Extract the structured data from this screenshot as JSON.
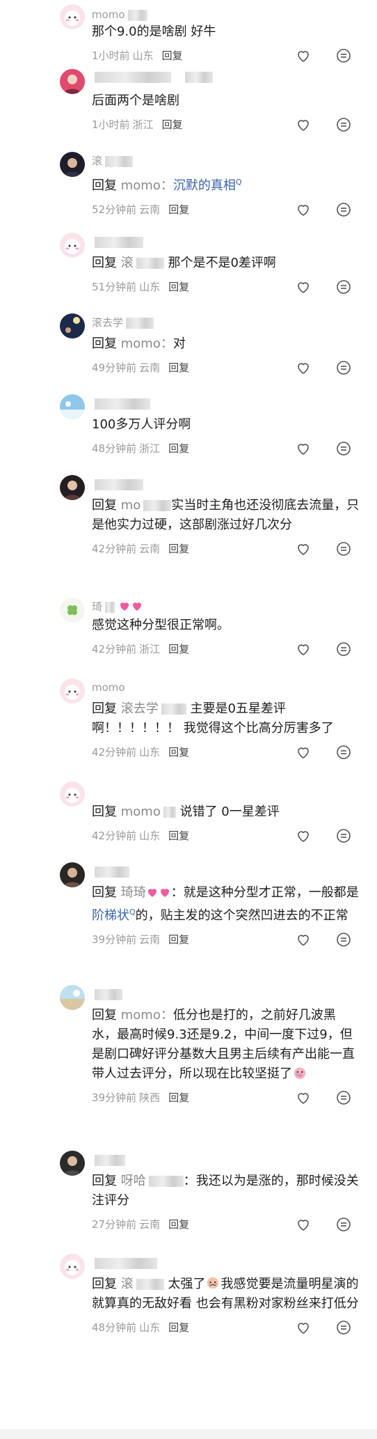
{
  "comments": [
    {
      "username": "momo",
      "content": "那个9.0的是啥剧 好牛",
      "time": "1小时前",
      "location": "山东",
      "reply_label": "回复"
    },
    {
      "username": "",
      "content": "后面两个是啥剧",
      "time": "1小时前",
      "location": "浙江",
      "reply_label": "回复"
    },
    {
      "username": "滚",
      "reply_kw": "回复",
      "ref_name": "momo：",
      "link_text": "沉默的真相",
      "time": "52分钟前",
      "location": "云南",
      "reply_label": "回复"
    },
    {
      "username": "",
      "reply_kw": "回复",
      "ref_name": "滚",
      "content": "那个是不是0差评啊",
      "time": "51分钟前",
      "location": "山东",
      "reply_label": "回复"
    },
    {
      "username": "滚去学",
      "reply_kw": "回复",
      "ref_name": "momo：",
      "content": "对",
      "time": "49分钟前",
      "location": "云南",
      "reply_label": "回复"
    },
    {
      "username": "",
      "content": "100多万人评分啊",
      "time": "48分钟前",
      "location": "浙江",
      "reply_label": "回复"
    },
    {
      "username": "",
      "reply_kw": "回复",
      "ref_name": "mo",
      "content": "实当时主角也还没彻底去流量，只是他实力过硬，这部剧涨过好几次分",
      "time": "42分钟前",
      "location": "云南",
      "reply_label": "回复"
    },
    {
      "username": "琦",
      "content": "感觉这种分型很正常啊。",
      "time": "42分钟前",
      "location": "浙江",
      "reply_label": "回复"
    },
    {
      "username": "momo",
      "reply_kw": "回复",
      "ref_name": "滚去学",
      "content": "主要是0五星差评啊！！！！！！ 我觉得这个比高分厉害多了",
      "time": "42分钟前",
      "location": "山东",
      "reply_label": "回复"
    },
    {
      "username": "",
      "reply_kw": "回复",
      "ref_name": "momo",
      "content": "说错了 0一星差评",
      "time": "42分钟前",
      "location": "山东",
      "reply_label": "回复"
    },
    {
      "username": "",
      "reply_kw": "回复",
      "ref_name": "琦琦",
      "content_a": "：就是这种分型才正常，一般都是",
      "link_text": "阶梯状",
      "content_b": "的，贴主发的这个突然凹进去的不正常",
      "time": "39分钟前",
      "location": "云南",
      "reply_label": "回复"
    },
    {
      "username": "",
      "reply_kw": "回复",
      "ref_name": "momo：",
      "content": "低分也是打的，之前好几波黑水，最高时候9.3还是9.2，中间一度下过9，但是剧口碑好评分基数大且男主后续有产出能一直带人过去评分，所以现在比较坚挺了",
      "time": "39分钟前",
      "location": "陕西",
      "reply_label": "回复"
    },
    {
      "username": "",
      "reply_kw": "回复",
      "ref_name": "呀哈",
      "content": "：我还以为是涨的，那时候没关注评分",
      "time": "27分钟前",
      "location": "云南",
      "reply_label": "回复"
    },
    {
      "username": "",
      "reply_kw": "回复",
      "ref_name": "滚",
      "content_a": "太强了",
      "content_b": "我感觉要是流量明星演的 就算真的无敌好看 也会有黑粉对家粉丝来打低分",
      "time": "48分钟前",
      "location": "山东",
      "reply_label": "回复"
    }
  ],
  "icons": {
    "like": "heart-outline-icon",
    "more": "more-dots-icon"
  },
  "colors": {
    "link": "#3a64a8",
    "meta": "#9a9a9a",
    "text": "#1e1e1e"
  }
}
